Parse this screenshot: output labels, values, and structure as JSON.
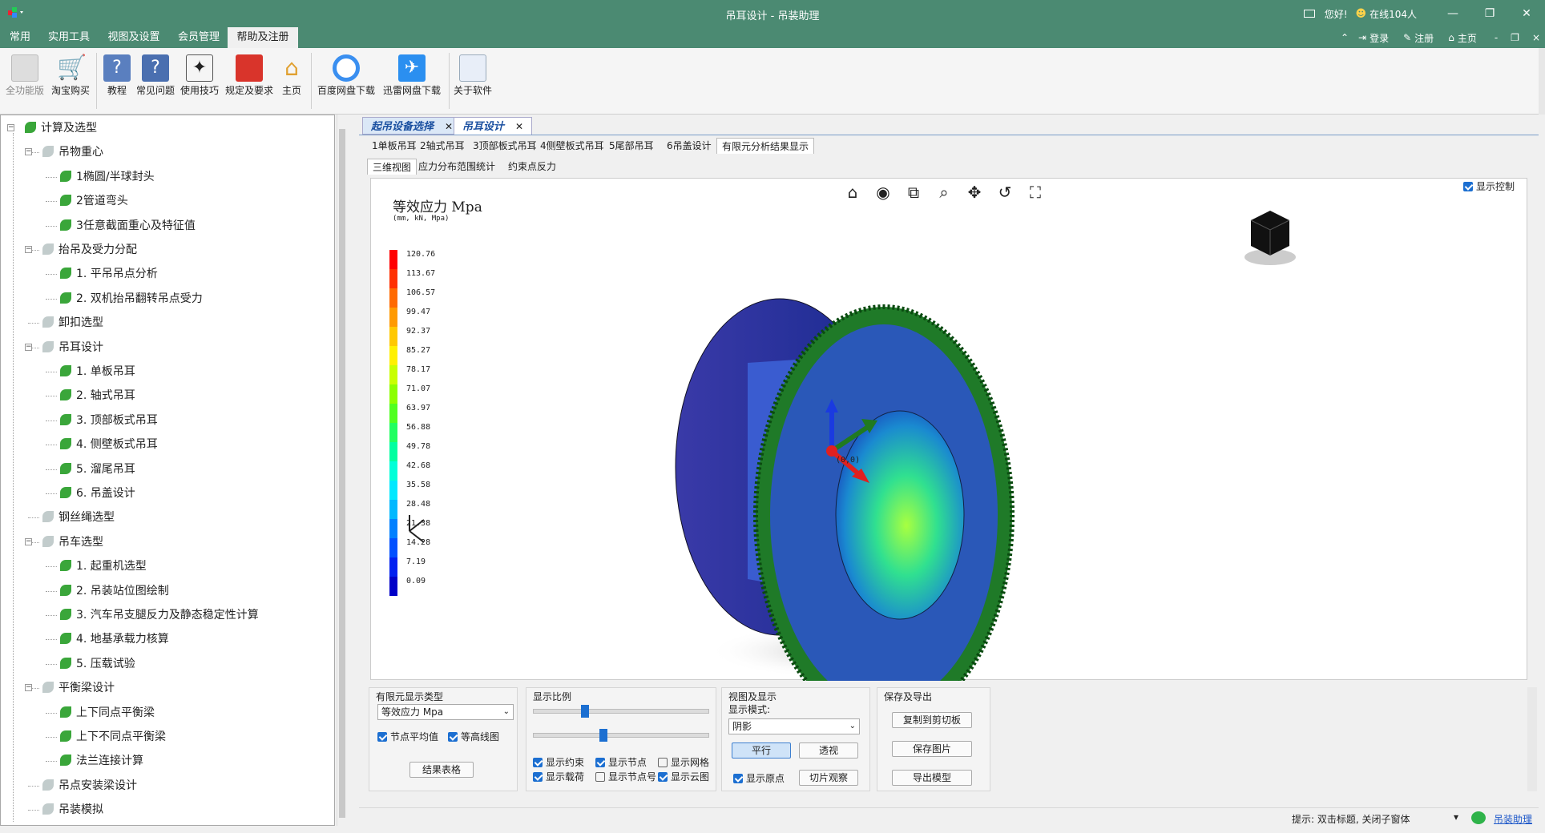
{
  "window": {
    "title": "吊耳设计 - 吊装助理",
    "greeting": "您好!",
    "online": "在线104人"
  },
  "menu": {
    "tabs": [
      "常用",
      "实用工具",
      "视图及设置",
      "会员管理",
      "帮助及注册"
    ],
    "active": 4,
    "right": [
      "登录",
      "注册",
      "主页"
    ]
  },
  "ribbon": {
    "buttons": [
      "全功能版",
      "淘宝购买",
      "教程",
      "常见问题",
      "使用技巧",
      "规定及要求",
      "主页",
      "百度网盘下载",
      "迅雷网盘下载",
      "关于软件"
    ]
  },
  "tree": {
    "items": [
      {
        "label": "计算及选型",
        "level": 0,
        "icon": "leaf"
      },
      {
        "label": "吊物重心",
        "level": 1,
        "icon": "gravity"
      },
      {
        "label": "1椭圆/半球封头",
        "level": 2,
        "icon": "leaf"
      },
      {
        "label": "2管道弯头",
        "level": 2,
        "icon": "leaf"
      },
      {
        "label": "3任意截面重心及特征值",
        "level": 2,
        "icon": "leaf"
      },
      {
        "label": "抬吊及受力分配",
        "level": 1,
        "icon": "beam"
      },
      {
        "label": "1. 平吊吊点分析",
        "level": 2,
        "icon": "leaf"
      },
      {
        "label": "2. 双机抬吊翻转吊点受力",
        "level": 2,
        "icon": "leaf"
      },
      {
        "label": "卸扣选型",
        "level": 1,
        "icon": "shackle"
      },
      {
        "label": "吊耳设计",
        "level": 1,
        "icon": "lug"
      },
      {
        "label": "1. 单板吊耳",
        "level": 2,
        "icon": "leaf"
      },
      {
        "label": "2. 轴式吊耳",
        "level": 2,
        "icon": "leaf"
      },
      {
        "label": "3. 顶部板式吊耳",
        "level": 2,
        "icon": "leaf"
      },
      {
        "label": "4. 侧壁板式吊耳",
        "level": 2,
        "icon": "leaf"
      },
      {
        "label": "5. 溜尾吊耳",
        "level": 2,
        "icon": "leaf"
      },
      {
        "label": "6. 吊盖设计",
        "level": 2,
        "icon": "leaf"
      },
      {
        "label": "钢丝绳选型",
        "level": 1,
        "icon": "rope"
      },
      {
        "label": "吊车选型",
        "level": 1,
        "icon": "crane"
      },
      {
        "label": "1. 起重机选型",
        "level": 2,
        "icon": "leaf"
      },
      {
        "label": "2. 吊装站位图绘制",
        "level": 2,
        "icon": "leaf"
      },
      {
        "label": "3. 汽车吊支腿反力及静态稳定性计算",
        "level": 2,
        "icon": "leaf"
      },
      {
        "label": "4. 地基承载力核算",
        "level": 2,
        "icon": "leaf"
      },
      {
        "label": "5. 压载试验",
        "level": 2,
        "icon": "leaf"
      },
      {
        "label": "平衡梁设计",
        "level": 1,
        "icon": "beam"
      },
      {
        "label": "上下同点平衡梁",
        "level": 2,
        "icon": "leaf"
      },
      {
        "label": "上下不同点平衡梁",
        "level": 2,
        "icon": "leaf"
      },
      {
        "label": "法兰连接计算",
        "level": 2,
        "icon": "leaf"
      },
      {
        "label": "吊点安装梁设计",
        "level": 1,
        "icon": "beam"
      },
      {
        "label": "吊装模拟",
        "level": 1,
        "icon": "sim"
      },
      {
        "label": "吊运工装",
        "level": 1,
        "icon": "tool"
      }
    ]
  },
  "doc_tabs": [
    "起吊设备选择",
    "吊耳设计"
  ],
  "lug_tabs": [
    "1单板吊耳",
    "2轴式吊耳",
    "3顶部板式吊耳",
    "4侧壁板式吊耳",
    "5尾部吊耳",
    "6吊盖设计",
    "有限元分析结果显示"
  ],
  "view_tabs": [
    "三维视图",
    "应力分布范围统计",
    "约束点反力"
  ],
  "viewer": {
    "title": "等效应力 Mpa",
    "units": "(mm, kN, Mpa)",
    "display_control": "显示控制",
    "origin_label": "(0,0)",
    "legend": [
      "120.76",
      "113.67",
      "106.57",
      "99.47",
      "92.37",
      "85.27",
      "78.17",
      "71.07",
      "63.97",
      "56.88",
      "49.78",
      "42.68",
      "35.58",
      "28.48",
      "21.38",
      "14.28",
      "7.19",
      "0.09"
    ],
    "legend_colors": [
      "#ff0000",
      "#ff3000",
      "#ff6a00",
      "#ff9a00",
      "#ffc800",
      "#fff000",
      "#c8ff00",
      "#8cff00",
      "#50ff20",
      "#20ff60",
      "#00ffa0",
      "#00ffd8",
      "#00e8ff",
      "#00b8ff",
      "#0080ff",
      "#0050ff",
      "#0020f0",
      "#0000c8"
    ]
  },
  "panels": {
    "fe_type": {
      "title": "有限元显示类型",
      "select": "等效应力 Mpa",
      "avg": "节点平均值",
      "contour": "等高线图",
      "table": "结果表格"
    },
    "scale": {
      "title": "显示比例",
      "checks": [
        "显示约束",
        "显示节点",
        "显示网格",
        "显示载荷",
        "显示节点号",
        "显示云图"
      ],
      "checked": [
        true,
        true,
        false,
        true,
        false,
        true
      ],
      "slider1": 0.28,
      "slider2": 0.39
    },
    "view": {
      "title": "视图及显示",
      "mode_label": "显示模式:",
      "mode": "阴影",
      "parallel": "平行",
      "perspective": "透视",
      "origin": "显示原点",
      "slice": "切片观察"
    },
    "save": {
      "title": "保存及导出",
      "copy": "复制到剪切板",
      "save": "保存图片",
      "export": "导出模型"
    }
  },
  "status": {
    "hint": "提示: 双击标题, 关闭子窗体",
    "link": "吊装助理"
  }
}
